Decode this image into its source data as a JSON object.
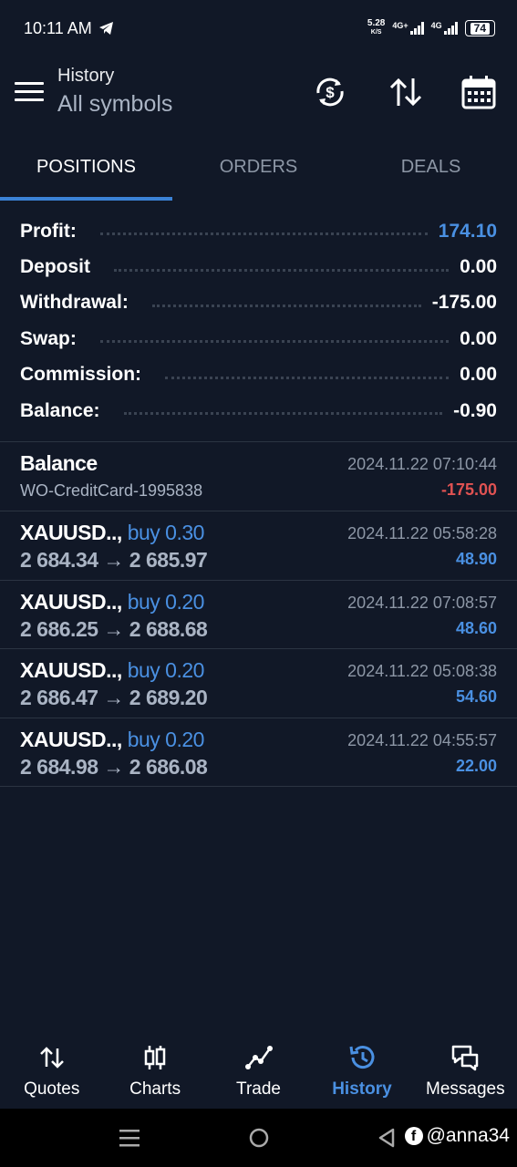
{
  "status_bar": {
    "time": "10:11 AM",
    "net_speed_value": "5.28",
    "net_speed_unit": "K/S",
    "sim1": "4G+",
    "sim2": "4G",
    "battery": "74"
  },
  "header": {
    "subtitle": "History",
    "title": "All symbols"
  },
  "tabs": [
    {
      "label": "POSITIONS",
      "active": true
    },
    {
      "label": "ORDERS",
      "active": false
    },
    {
      "label": "DEALS",
      "active": false
    }
  ],
  "summary": [
    {
      "label": "Profit:",
      "value": "174.10"
    },
    {
      "label": "Deposit",
      "value": "0.00"
    },
    {
      "label": "Withdrawal:",
      "value": "-175.00"
    },
    {
      "label": "Swap:",
      "value": "0.00"
    },
    {
      "label": "Commission:",
      "value": "0.00"
    },
    {
      "label": "Balance:",
      "value": "-0.90"
    }
  ],
  "balance_entry": {
    "title": "Balance",
    "comment": "WO-CreditCard-1995838",
    "time": "2024.11.22 07:10:44",
    "amount": "-175.00"
  },
  "positions": [
    {
      "symbol": "XAUUSD..,",
      "side": "buy 0.30",
      "prices": "2 684.34 → 2 685.97",
      "time": "2024.11.22 05:58:28",
      "profit": "48.90"
    },
    {
      "symbol": "XAUUSD..,",
      "side": "buy 0.20",
      "prices": "2 686.25 → 2 688.68",
      "time": "2024.11.22 07:08:57",
      "profit": "48.60"
    },
    {
      "symbol": "XAUUSD..,",
      "side": "buy 0.20",
      "prices": "2 686.47 → 2 689.20",
      "time": "2024.11.22 05:08:38",
      "profit": "54.60"
    },
    {
      "symbol": "XAUUSD..,",
      "side": "buy 0.20",
      "prices": "2 684.98 → 2 686.08",
      "time": "2024.11.22 04:55:57",
      "profit": "22.00"
    }
  ],
  "bottom_nav": [
    {
      "label": "Quotes",
      "icon": "arrows-updown-icon"
    },
    {
      "label": "Charts",
      "icon": "candlestick-icon"
    },
    {
      "label": "Trade",
      "icon": "trend-line-icon"
    },
    {
      "label": "History",
      "icon": "clock-history-icon",
      "active": true
    },
    {
      "label": "Messages",
      "icon": "chat-bubbles-icon"
    }
  ],
  "watermark": "@anna34",
  "colors": {
    "background": "#111827",
    "accent_blue": "#4a90e2",
    "loss_red": "#e05252",
    "muted_text": "#8d97a6"
  }
}
